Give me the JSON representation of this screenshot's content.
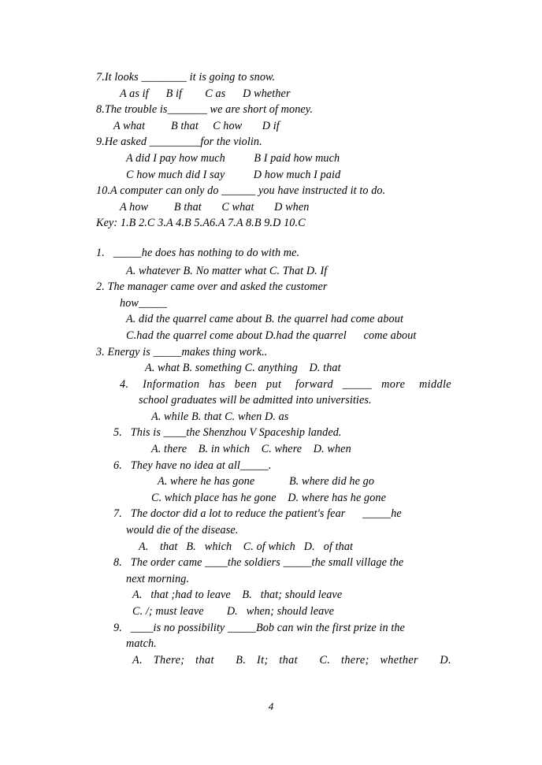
{
  "document": {
    "page_number": "4",
    "sections": [
      {
        "id": "section-one",
        "items": [
          {
            "stem": "7.It looks ________ it is going to snow.",
            "options_lines": [
              "A as if      B if        C as      D whether"
            ]
          },
          {
            "stem": "8.The trouble is_______ we are short of money.",
            "options_lines": [
              "A what         B that     C how       D if"
            ]
          },
          {
            "stem": "9.He asked _________for the violin.",
            "options_lines": [
              "A did I pay how much          B I paid how much",
              "C how much did I say          D how much I paid"
            ]
          },
          {
            "stem": "10.A computer can only do ______ you have instructed it to do.",
            "options_lines": [
              "A how         B that       C what       D when"
            ]
          }
        ],
        "key_line": "Key: 1.B 2.C 3.A 4.B 5.A6.A 7.A 8.B 9.D 10.C"
      },
      {
        "id": "section-two",
        "items": [
          {
            "stem_lines": [
              "1.   _____he does has nothing to do with me."
            ],
            "options_lines": [
              "A. whatever B. No matter what C. That D. If"
            ]
          },
          {
            "stem_lines": [
              "2. The manager came over and asked the customer",
              "how_____"
            ],
            "options_lines": [
              "A. did the quarrel came about B. the quarrel had come about",
              "C.had the quarrel come about D.had the quarrel      come about"
            ]
          },
          {
            "stem_lines": [
              "3. Energy is _____makes thing work.."
            ],
            "options_lines": [
              "A. what B. something C. anything    D. that"
            ]
          },
          {
            "stem_lines": [
              "4.   Information  has  been  put   forward  _____  more   middle",
              "school graduates will be admitted into universities."
            ],
            "options_lines": [
              "A. while B. that C. when D. as"
            ]
          },
          {
            "stem_lines": [
              "5.   This is ____the Shenzhou V Spaceship landed."
            ],
            "options_lines": [
              "A. there    B. in which    C. where    D. when"
            ]
          },
          {
            "stem_lines": [
              "6.   They have no idea at all_____."
            ],
            "options_lines": [
              "A. where he has gone            B. where did he go",
              "C. which place has he gone    D. where has he gone"
            ]
          },
          {
            "stem_lines": [
              "7.   The doctor did a lot to reduce the patient's fear      _____he",
              "would die of the disease."
            ],
            "options_lines": [
              "A.    that   B.   which    C. of which   D.   of that"
            ]
          },
          {
            "stem_lines": [
              "8.   The order came ____the soldiers _____the small village the",
              "next morning."
            ],
            "options_lines": [
              "A.   that ;had to leave    B.   that; should leave",
              "C. /; must leave        D.   when; should leave"
            ]
          },
          {
            "stem_lines": [
              "9.   ____is no possibility _____Bob can win the first prize in the",
              "match."
            ],
            "options_lines": [
              "A.  There;  that    B.  It;  that    C.  there;  whether    D."
            ]
          }
        ]
      }
    ]
  }
}
